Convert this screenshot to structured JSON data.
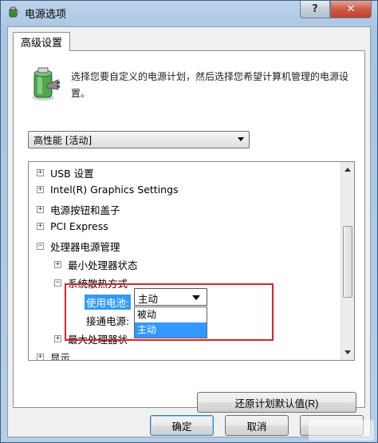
{
  "window": {
    "title": "电源选项",
    "help_label": "?",
    "close_label": "✕"
  },
  "tab": {
    "label": "高级设置"
  },
  "description": "选择您要自定义的电源计划，然后选择您希望计算机管理的电源设置。",
  "plan_select": {
    "value": "高性能 [活动]"
  },
  "tree": {
    "items": [
      {
        "toggle": "+",
        "label": "USB 设置"
      },
      {
        "toggle": "+",
        "label": "Intel(R) Graphics Settings"
      },
      {
        "toggle": "+",
        "label": "电源按钮和盖子"
      },
      {
        "toggle": "+",
        "label": "PCI Express"
      },
      {
        "toggle": "−",
        "label": "处理器电源管理"
      },
      {
        "toggle": "+",
        "label": "最小处理器状态"
      },
      {
        "toggle": "−",
        "label": "系统散热方式"
      },
      {
        "toggle": "",
        "label": "使用电池:"
      },
      {
        "toggle": "",
        "label": "接通电源:"
      },
      {
        "toggle": "+",
        "label": "最大处理器状"
      },
      {
        "toggle": "+",
        "label": "显示"
      }
    ],
    "combo_value": "主动",
    "dropdown_options": [
      "被动",
      "主动"
    ]
  },
  "buttons": {
    "restore": "还原计划默认值(R)",
    "ok": "确定",
    "cancel": "取消",
    "apply": ""
  },
  "colors": {
    "highlight_box": "#e0202a",
    "selection": "#3399ff"
  }
}
